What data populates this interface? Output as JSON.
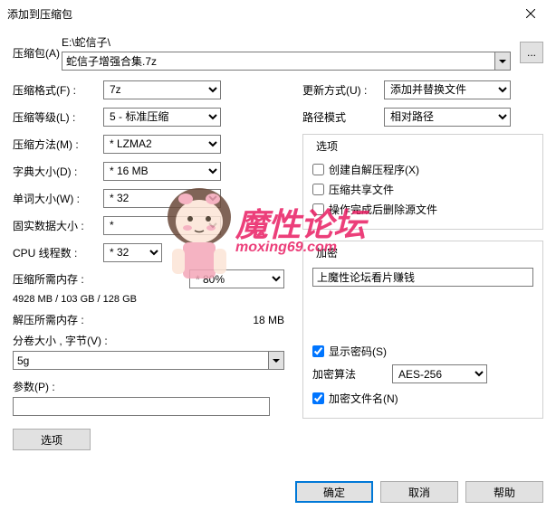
{
  "title": "添加到压缩包",
  "archive": {
    "label": "压缩包(A)",
    "path": "E:\\蛇信子\\",
    "filename": "蛇信子增强合集.7z"
  },
  "format": {
    "label": "压缩格式(F) :",
    "value": "7z"
  },
  "level": {
    "label": "压缩等级(L) :",
    "value": "5 - 标准压缩"
  },
  "method": {
    "label": "压缩方法(M) :",
    "value": "* LZMA2"
  },
  "dict": {
    "label": "字典大小(D) :",
    "value": "* 16 MB"
  },
  "word": {
    "label": "单词大小(W) :",
    "value": "* 32"
  },
  "solid": {
    "label": "固实数据大小 :",
    "value": "*"
  },
  "cpu": {
    "label": "CPU 线程数 :",
    "value": "* 32"
  },
  "compress_mem": {
    "label": "压缩所需内存 :",
    "value": "* 80%",
    "detail": "4928 MB / 103 GB / 128 GB"
  },
  "decompress_mem": {
    "label": "解压所需内存 :",
    "value": "18 MB"
  },
  "volume": {
    "label": "分卷大小 , 字节(V) :",
    "value": "5g"
  },
  "params": {
    "label": "参数(P) :",
    "value": ""
  },
  "options_btn": "选项",
  "update": {
    "label": "更新方式(U) :",
    "value": "添加并替换文件"
  },
  "pathmode": {
    "label": "路径模式",
    "value": "相对路径"
  },
  "opts": {
    "title": "选项",
    "sfx": "创建自解压程序(X)",
    "shared": "压缩共享文件",
    "delete": "操作完成后删除源文件"
  },
  "enc": {
    "title": "加密",
    "password": "上魔性论坛看片赚钱",
    "show": "显示密码(S)",
    "algo_label": "加密算法",
    "algo": "AES-256",
    "names": "加密文件名(N)"
  },
  "buttons": {
    "ok": "确定",
    "cancel": "取消",
    "help": "帮助"
  },
  "watermark": {
    "text1": "魔性论坛",
    "text2": "moxing69.com"
  }
}
